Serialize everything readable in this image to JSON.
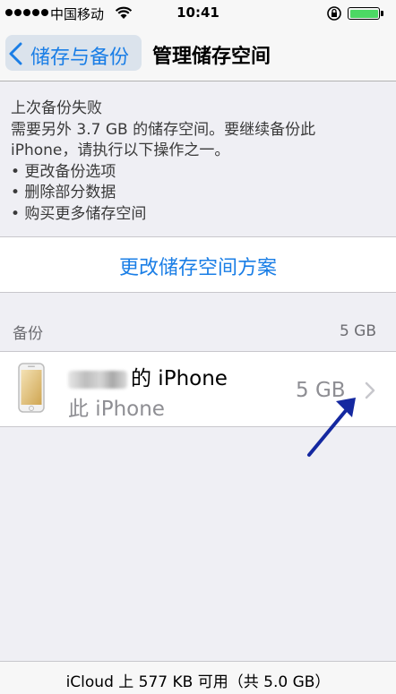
{
  "status_bar": {
    "carrier": "中国移动",
    "time": "10:41",
    "battery_level": 1.0,
    "battery_color": "#4cd964"
  },
  "nav": {
    "back_label": "储存与备份",
    "title": "管理储存空间"
  },
  "warning": {
    "lines": [
      "上次备份失败",
      "需要另外 3.7 GB 的储存空间。要继续备份此",
      "iPhone，请执行以下操作之一。",
      "• 更改备份选项",
      "• 删除部分数据",
      "• 购买更多储存空间"
    ]
  },
  "plan_button": {
    "label": "更改储存空间方案"
  },
  "backups": {
    "header": "备份",
    "total": "5 GB",
    "items": [
      {
        "name_suffix": "的 iPhone",
        "subtitle": "此 iPhone",
        "size": "5 GB"
      }
    ]
  },
  "footer": {
    "text": "iCloud 上 577 KB 可用（共 5.0 GB）"
  },
  "colors": {
    "accent": "#1a7ee6",
    "annotation_arrow": "#1428a0"
  }
}
